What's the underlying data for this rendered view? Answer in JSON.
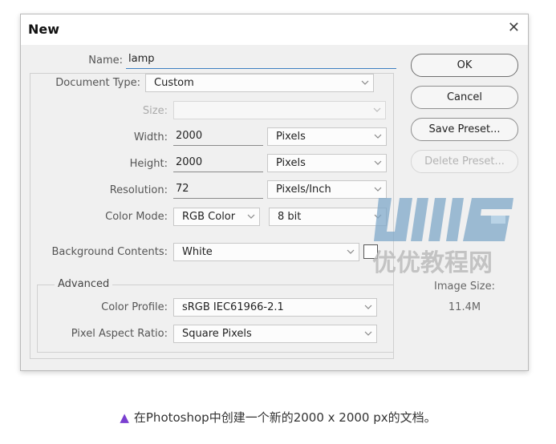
{
  "dialog": {
    "title": "New",
    "name_label": "Name:",
    "name_value": "lamp",
    "document_type_label": "Document Type:",
    "document_type_value": "Custom",
    "size_label": "Size:",
    "size_value": "",
    "width_label": "Width:",
    "width_value": "2000",
    "width_unit": "Pixels",
    "height_label": "Height:",
    "height_value": "2000",
    "height_unit": "Pixels",
    "resolution_label": "Resolution:",
    "resolution_value": "72",
    "resolution_unit": "Pixels/Inch",
    "color_mode_label": "Color Mode:",
    "color_mode_value": "RGB Color",
    "bit_depth_value": "8 bit",
    "background_label": "Background Contents:",
    "background_value": "White",
    "advanced_label": "Advanced",
    "color_profile_label": "Color Profile:",
    "color_profile_value": "sRGB IEC61966-2.1",
    "pixel_aspect_label": "Pixel Aspect Ratio:",
    "pixel_aspect_value": "Square Pixels",
    "image_size_label": "Image Size:",
    "image_size_value": "11.4M"
  },
  "buttons": {
    "ok": "OK",
    "cancel": "Cancel",
    "save_preset": "Save Preset...",
    "delete_preset": "Delete Preset..."
  },
  "watermark": {
    "text": "优优教程网"
  },
  "caption": "在Photoshop中创建一个新的2000 x 2000 px的文档。",
  "colors": {
    "accent": "#3d7fc1",
    "caption_triangle": "#7a3fd0",
    "watermark": "#7fa8c9"
  },
  "icons": {
    "close": "close-icon",
    "dropdown": "chevron-down-icon",
    "caption_bullet": "triangle-icon"
  }
}
